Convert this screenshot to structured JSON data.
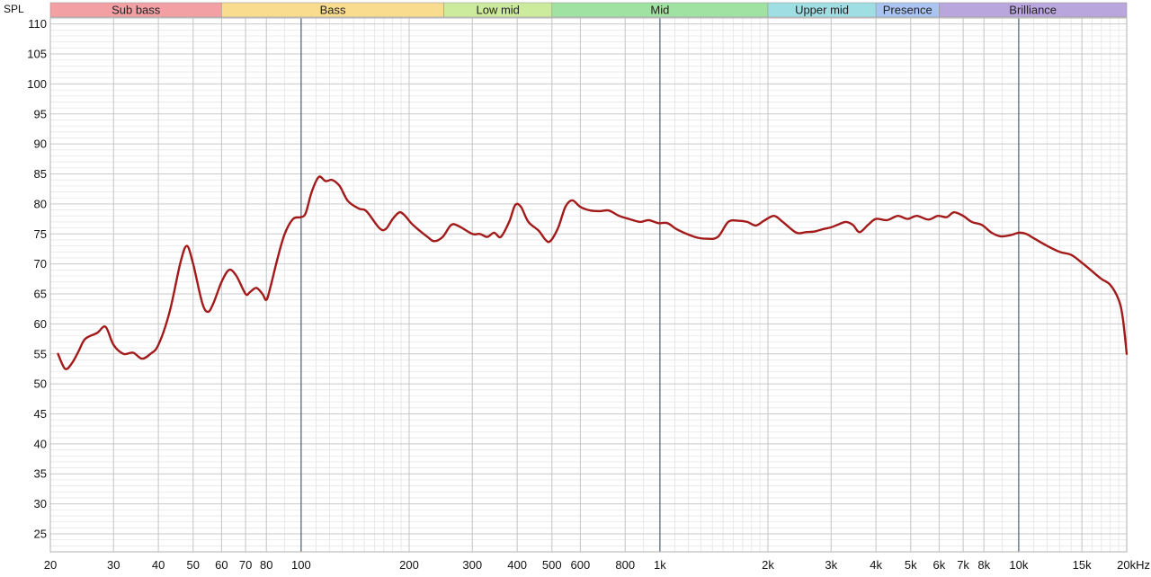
{
  "chart_data": {
    "type": "line",
    "yaxis_label": "SPL",
    "x_scale": "log",
    "xlim": [
      20,
      20000
    ],
    "ylim": [
      22,
      111
    ],
    "grid": true,
    "x_ticks": [
      {
        "v": 20,
        "label": "20"
      },
      {
        "v": 30,
        "label": "30"
      },
      {
        "v": 40,
        "label": "40"
      },
      {
        "v": 50,
        "label": "50"
      },
      {
        "v": 60,
        "label": "60"
      },
      {
        "v": 70,
        "label": "70"
      },
      {
        "v": 80,
        "label": "80"
      },
      {
        "v": 100,
        "label": "100"
      },
      {
        "v": 200,
        "label": "200"
      },
      {
        "v": 300,
        "label": "300"
      },
      {
        "v": 400,
        "label": "400"
      },
      {
        "v": 500,
        "label": "500"
      },
      {
        "v": 600,
        "label": "600"
      },
      {
        "v": 800,
        "label": "800"
      },
      {
        "v": 1000,
        "label": "1k"
      },
      {
        "v": 2000,
        "label": "2k"
      },
      {
        "v": 3000,
        "label": "3k"
      },
      {
        "v": 4000,
        "label": "4k"
      },
      {
        "v": 5000,
        "label": "5k"
      },
      {
        "v": 6000,
        "label": "6k"
      },
      {
        "v": 7000,
        "label": "7k"
      },
      {
        "v": 8000,
        "label": "8k"
      },
      {
        "v": 10000,
        "label": "10k"
      },
      {
        "v": 15000,
        "label": "15k"
      },
      {
        "v": 20000,
        "label": "20kHz"
      }
    ],
    "y_ticks": [
      25,
      30,
      35,
      40,
      45,
      50,
      55,
      60,
      65,
      70,
      75,
      80,
      85,
      90,
      95,
      100,
      105,
      110
    ],
    "bands": [
      {
        "name": "Sub bass",
        "from": 20,
        "to": 60,
        "color": "#f2a0a4"
      },
      {
        "name": "Bass",
        "from": 60,
        "to": 250,
        "color": "#f9dc8e"
      },
      {
        "name": "Low mid",
        "from": 250,
        "to": 500,
        "color": "#cdeb9c"
      },
      {
        "name": "Mid",
        "from": 500,
        "to": 2000,
        "color": "#9fe2a1"
      },
      {
        "name": "Upper mid",
        "from": 2000,
        "to": 4000,
        "color": "#9fdfe3"
      },
      {
        "name": "Presence",
        "from": 4000,
        "to": 6000,
        "color": "#a9c4f0"
      },
      {
        "name": "Brilliance",
        "from": 6000,
        "to": 20000,
        "color": "#b9a6dc"
      }
    ],
    "series": [
      {
        "color": "#a31a1a",
        "points": [
          [
            21,
            55
          ],
          [
            22,
            52.5
          ],
          [
            23,
            53.5
          ],
          [
            24,
            55.5
          ],
          [
            25,
            57.5
          ],
          [
            27,
            58.5
          ],
          [
            28.5,
            59.5
          ],
          [
            30,
            56.5
          ],
          [
            32,
            55
          ],
          [
            34,
            55.2
          ],
          [
            36,
            54.2
          ],
          [
            38,
            55
          ],
          [
            40,
            56.5
          ],
          [
            43,
            62
          ],
          [
            46,
            70
          ],
          [
            48,
            73
          ],
          [
            50,
            70
          ],
          [
            53,
            63.5
          ],
          [
            55,
            62
          ],
          [
            57,
            63.5
          ],
          [
            60,
            67
          ],
          [
            63,
            69
          ],
          [
            66,
            68
          ],
          [
            70,
            65
          ],
          [
            72,
            65.3
          ],
          [
            75,
            66
          ],
          [
            78,
            65
          ],
          [
            80,
            64
          ],
          [
            82,
            66
          ],
          [
            86,
            71
          ],
          [
            90,
            75
          ],
          [
            95,
            77.5
          ],
          [
            100,
            77.8
          ],
          [
            103,
            78.5
          ],
          [
            107,
            82
          ],
          [
            112,
            84.5
          ],
          [
            117,
            83.8
          ],
          [
            122,
            84
          ],
          [
            128,
            83
          ],
          [
            135,
            80.5
          ],
          [
            145,
            79.2
          ],
          [
            152,
            78.8
          ],
          [
            165,
            76
          ],
          [
            172,
            75.8
          ],
          [
            180,
            77.5
          ],
          [
            188,
            78.6
          ],
          [
            195,
            78
          ],
          [
            205,
            76.5
          ],
          [
            225,
            74.5
          ],
          [
            235,
            73.8
          ],
          [
            248,
            74.5
          ],
          [
            262,
            76.5
          ],
          [
            275,
            76.3
          ],
          [
            300,
            75
          ],
          [
            315,
            75
          ],
          [
            330,
            74.5
          ],
          [
            345,
            75.2
          ],
          [
            360,
            74.5
          ],
          [
            380,
            77
          ],
          [
            395,
            79.8
          ],
          [
            410,
            79.5
          ],
          [
            430,
            77
          ],
          [
            460,
            75.5
          ],
          [
            480,
            74
          ],
          [
            495,
            73.8
          ],
          [
            520,
            76
          ],
          [
            545,
            79.5
          ],
          [
            570,
            80.6
          ],
          [
            600,
            79.5
          ],
          [
            640,
            78.9
          ],
          [
            680,
            78.8
          ],
          [
            720,
            78.9
          ],
          [
            770,
            78
          ],
          [
            820,
            77.5
          ],
          [
            880,
            77
          ],
          [
            930,
            77.3
          ],
          [
            990,
            76.8
          ],
          [
            1050,
            76.8
          ],
          [
            1120,
            75.7
          ],
          [
            1250,
            74.5
          ],
          [
            1350,
            74.2
          ],
          [
            1450,
            74.5
          ],
          [
            1550,
            77
          ],
          [
            1650,
            77.2
          ],
          [
            1750,
            77
          ],
          [
            1850,
            76.4
          ],
          [
            1950,
            77.2
          ],
          [
            2080,
            78
          ],
          [
            2200,
            77
          ],
          [
            2400,
            75.2
          ],
          [
            2550,
            75.3
          ],
          [
            2700,
            75.4
          ],
          [
            2850,
            75.8
          ],
          [
            3000,
            76.1
          ],
          [
            3150,
            76.6
          ],
          [
            3300,
            77
          ],
          [
            3450,
            76.5
          ],
          [
            3600,
            75.3
          ],
          [
            3800,
            76.5
          ],
          [
            4000,
            77.5
          ],
          [
            4300,
            77.3
          ],
          [
            4600,
            78
          ],
          [
            4900,
            77.5
          ],
          [
            5200,
            78
          ],
          [
            5600,
            77.4
          ],
          [
            5950,
            78
          ],
          [
            6300,
            77.8
          ],
          [
            6600,
            78.6
          ],
          [
            7000,
            78
          ],
          [
            7400,
            77
          ],
          [
            7900,
            76.5
          ],
          [
            8400,
            75.2
          ],
          [
            8900,
            74.6
          ],
          [
            9500,
            74.8
          ],
          [
            10000,
            75.2
          ],
          [
            10500,
            75
          ],
          [
            11000,
            74.3
          ],
          [
            12000,
            73
          ],
          [
            13000,
            72
          ],
          [
            14000,
            71.5
          ],
          [
            15000,
            70.2
          ],
          [
            16000,
            68.8
          ],
          [
            17000,
            67.5
          ],
          [
            18000,
            66.5
          ],
          [
            19000,
            64
          ],
          [
            19500,
            61
          ],
          [
            20000,
            55
          ]
        ]
      }
    ]
  }
}
